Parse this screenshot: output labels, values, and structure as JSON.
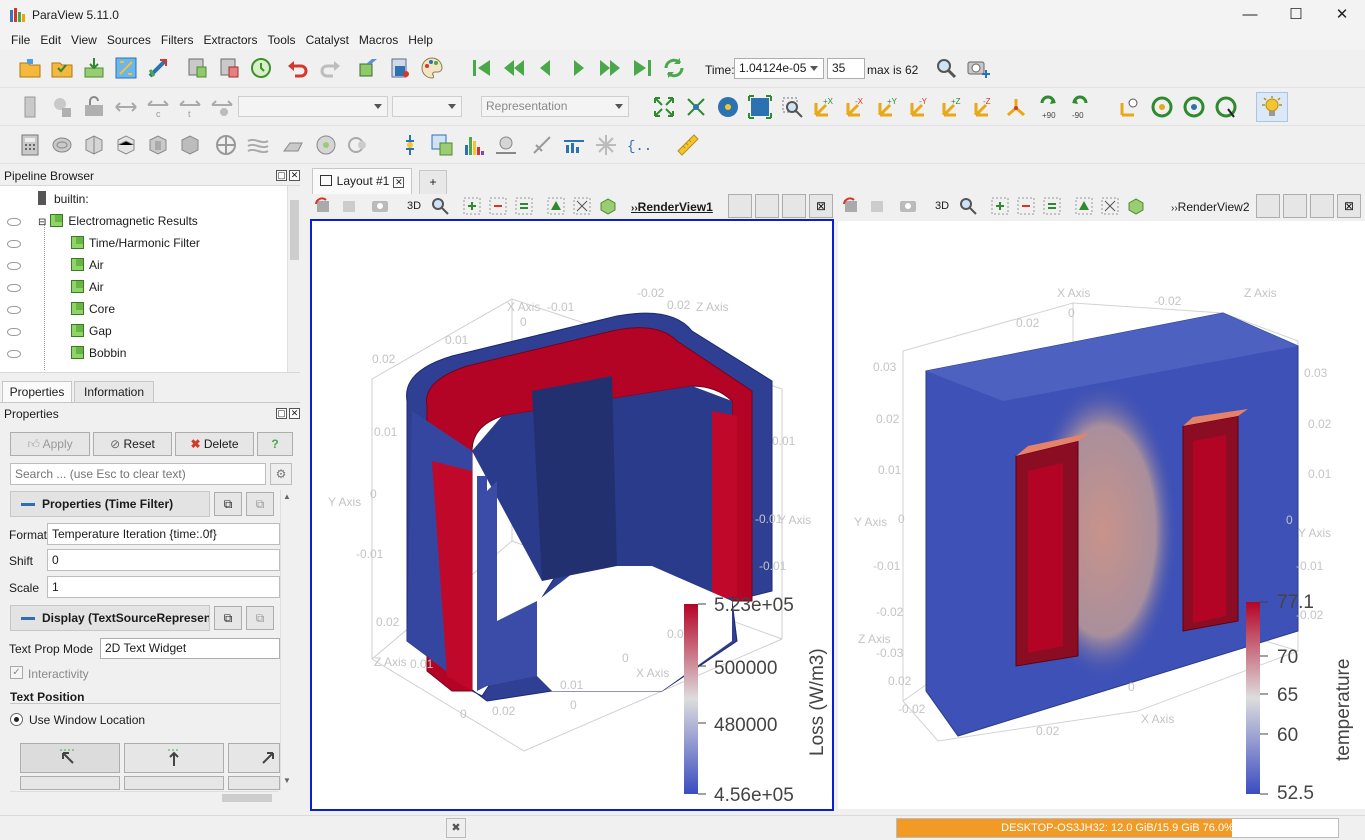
{
  "app": {
    "title": "ParaView 5.11.0"
  },
  "window_controls": {
    "minimize": "—",
    "maximize": "☐",
    "close": "✕"
  },
  "menu": [
    "File",
    "Edit",
    "View",
    "Sources",
    "Filters",
    "Extractors",
    "Tools",
    "Catalyst",
    "Macros",
    "Help"
  ],
  "toolbar": {
    "time_label": "Time:",
    "time_value": "1.04124e-05",
    "timestep": "35",
    "max_label": "max is 62",
    "representation": "Representation",
    "rotate_plus": "+90",
    "rotate_minus": "-90"
  },
  "pipeline": {
    "title": "Pipeline Browser",
    "items": [
      {
        "label": "builtin:"
      },
      {
        "label": "Electromagnetic Results"
      },
      {
        "label": "Time/Harmonic Filter"
      },
      {
        "label": "Air"
      },
      {
        "label": "Air"
      },
      {
        "label": "Core"
      },
      {
        "label": "Gap"
      },
      {
        "label": "Bobbin"
      }
    ]
  },
  "tabs": {
    "properties": "Properties",
    "information": "Information"
  },
  "properties": {
    "title": "Properties",
    "apply": "Apply",
    "reset": "Reset",
    "delete": "Delete",
    "help": "?",
    "search_placeholder": "Search ... (use Esc to clear text)",
    "section1": "Properties (Time Filter)",
    "format_label": "Format",
    "format_value": "Temperature Iteration {time:.0f}",
    "shift_label": "Shift",
    "shift_value": "0",
    "scale_label": "Scale",
    "scale_value": "1",
    "section2": "Display (TextSourceRepresentation)",
    "text_prop_label": "Text Prop Mode",
    "text_prop_value": "2D Text Widget",
    "interactivity": "Interactivity",
    "text_position": "Text Position",
    "use_window_location": "Use Window Location"
  },
  "layout": {
    "tab": "Layout #1",
    "add_tab": "+"
  },
  "views": {
    "view1": {
      "name": "RenderView1",
      "button3d": "3D"
    },
    "view2": {
      "name": "RenderView2",
      "button3d": "3D"
    }
  },
  "viewport1": {
    "axis_labels": {
      "x1": "X Axis",
      "z1": "Z Axis",
      "y1": "Y Axis",
      "y2": "Y Axis",
      "z2": "Z Axis",
      "x2": "X Axis"
    },
    "ticks": [
      "-0.01",
      "-0.02",
      "0.02",
      "0",
      "0.01",
      "0.02",
      "0.01",
      "0",
      "-0.01",
      "0.01",
      "-0.01",
      "0.01",
      "0.02",
      "0",
      "0.01",
      "0.02",
      "0.01",
      "0",
      "-0.01",
      "0"
    ],
    "colorbar": {
      "title": "Loss (W/m3)",
      "max": "5.23e+05",
      "mid1": "500000",
      "mid2": "480000",
      "min": "4.56e+05",
      "colors": {
        "high": "#b40426",
        "mid": "#dddddd",
        "low": "#3b4cc0"
      }
    }
  },
  "viewport2": {
    "axis_labels": {
      "x1": "X Axis",
      "z1": "Z Axis",
      "y1": "Y Axis",
      "y2": "Y Axis",
      "z2": "Z Axis",
      "x2": "X Axis"
    },
    "ticks": [
      "0.02",
      "0",
      "-0.02",
      "0.03",
      "0.03",
      "0.02",
      "0.02",
      "0.01",
      "0.01",
      "0",
      "0",
      "-0.01",
      "-0.01",
      "-0.02",
      "-0.02",
      "-0.03",
      "0.02",
      "0",
      "-0.02",
      "0.02"
    ],
    "colorbar": {
      "title": "temperature",
      "max": "77.1",
      "t70": "70",
      "t65": "65",
      "t60": "60",
      "min": "52.5"
    }
  },
  "status": {
    "memory": "DESKTOP-OS3JH32: 12.0 GiB/15.9 GiB 76.0%",
    "memory_fraction": 0.76
  }
}
